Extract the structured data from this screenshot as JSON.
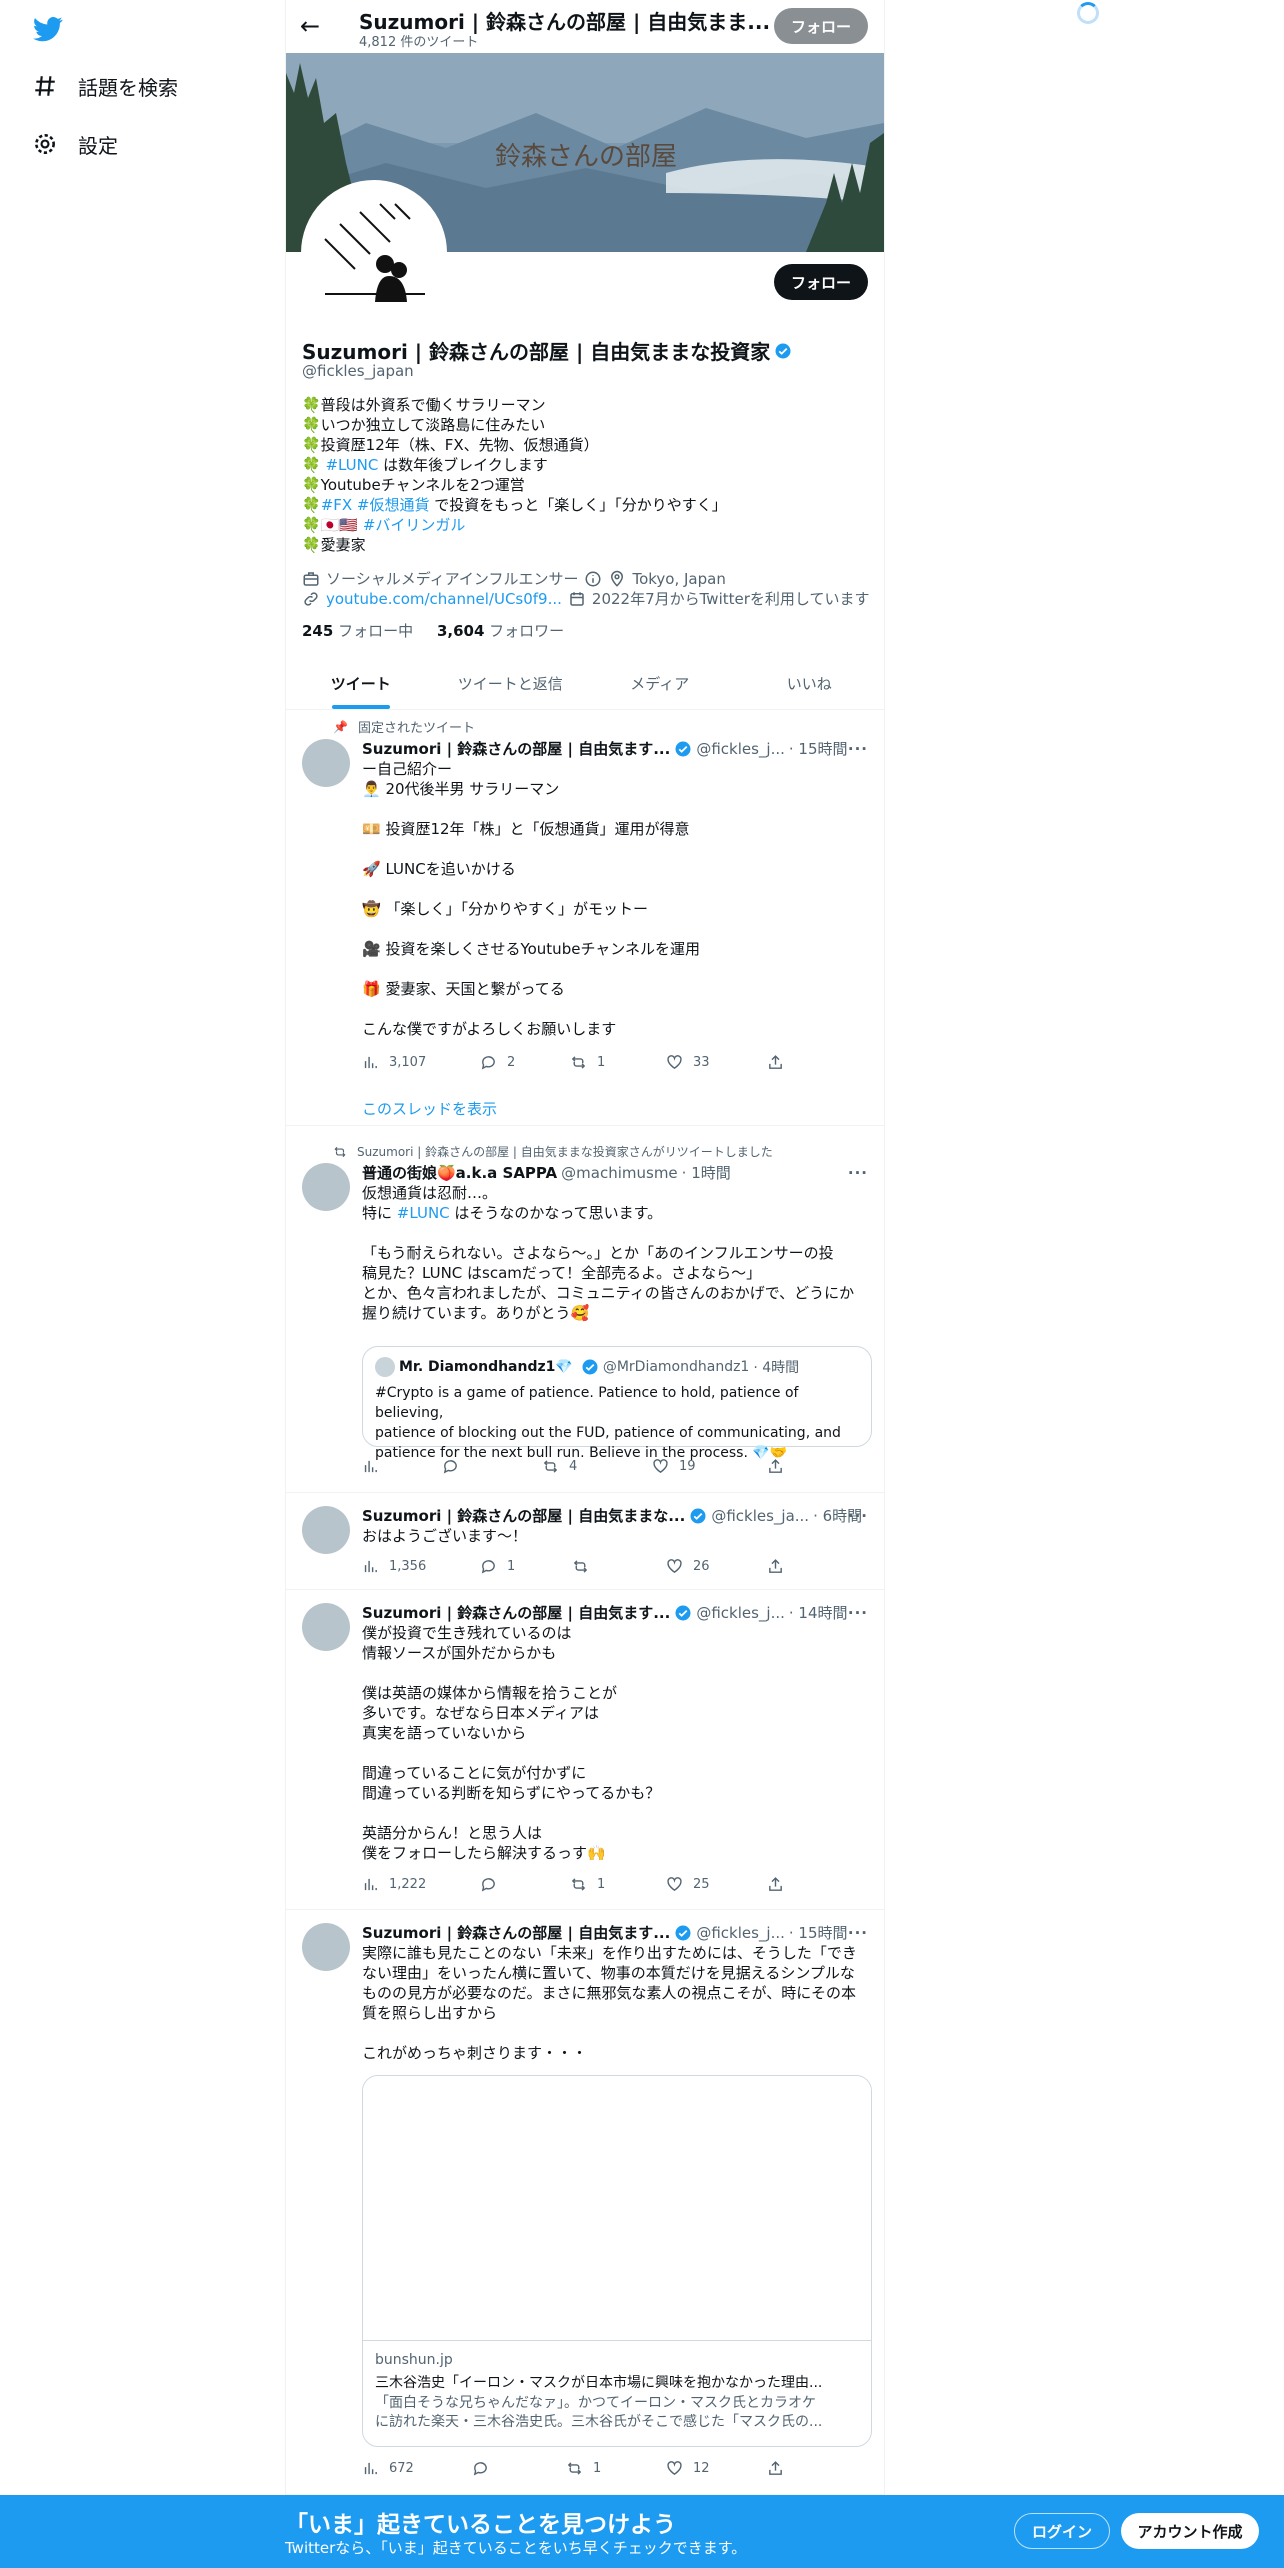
{
  "nav": {
    "explore": "話題を検索",
    "settings": "設定"
  },
  "topbar": {
    "name": "Suzumori | 鈴森さんの部屋 | 自由気まま...",
    "count": "4,812 件のツイート",
    "follow": "フォロー"
  },
  "banner": {
    "text": "鈴森さんの部屋"
  },
  "profile": {
    "follow": "フォロー",
    "name": "Suzumori | 鈴森さんの部屋 | 自由気ままな投資家",
    "handle": "@fickles_japan",
    "bio": [
      "🍀普段は外資系で働くサラリーマン",
      "🍀いつか独立して淡路島に住みたい",
      "🍀投資歴12年（株、FX、先物、仮想通貨）",
      "🍀",
      "🍀Youtubeチャンネルを2つ運営",
      "🍀",
      "🍀",
      "🍀愛妻家"
    ],
    "bio_tag1": "#LUNC",
    "bio_line4_rest": " は数年後ブレイクします",
    "bio_tags6": "#FX #仮想通貨",
    "bio_line6_rest": " で投資をもっと「楽しく」「分かりやすく」",
    "bio_flags": "🇯🇵🇺🇸 ",
    "bio_tag7": "#バイリンガル",
    "category": "ソーシャルメディアインフルエンサー",
    "location": "Tokyo, Japan",
    "url": "youtube.com/channel/UCs0f9...",
    "joined": "2022年7月からTwitterを利用しています",
    "following_count": "245",
    "following_label": " フォロー中",
    "followers_count": "3,604",
    "followers_label": " フォロワー"
  },
  "tabs": [
    "ツイート",
    "ツイートと返信",
    "メディア",
    "いいね"
  ],
  "tweets": [
    {
      "context": "固定されたツイート",
      "name": "Suzumori | 鈴森さんの部屋 | 自由気ます...",
      "handle": "@fickles_j...",
      "time": "· 15時間",
      "lines": [
        "ー自己紹介ー",
        "👨‍💼 20代後半男 サラリーマン",
        "",
        "💴 投資歴12年「株」と「仮想通貨」運用が得意",
        "",
        "🚀 LUNCを追いかける",
        "",
        "🤠 「楽しく」「分かりやすく」がモットー",
        "",
        "🎥 投資を楽しくさせるYoutubeチャンネルを運用",
        "",
        "🎁 愛妻家、天国と繋がってる",
        "",
        "こんな僕ですがよろしくお願いします"
      ],
      "views": "3,107",
      "replies": "2",
      "retweets": "1",
      "likes": "33",
      "thread": "このスレッドを表示"
    },
    {
      "context": "Suzumori | 鈴森さんの部屋 | 自由気ままな投資家さんがリツイートしました",
      "name": "普通の街娘🍑a.k.a SAPPA",
      "handle": "@machimusme",
      "time": "· 1時間",
      "lines": [
        "仮想通貨は忍耐…。",
        "特に ",
        "",
        "「もう耐えられない。さよなら～。」とか「あのインフルエンサーの投",
        "稿見た？LUNC はscamだって！全部売るよ。さよなら～」",
        "とか、色々言われましたが、コミュニティの皆さんのおかげで、どうにか",
        "握り続けています。ありがとう🥰"
      ],
      "tag": "#LUNC",
      "line2_rest": " はそうなのかなって思います。",
      "quote": {
        "name": "Mr. Diamondhandz1💎",
        "handle": "@MrDiamondhandz1",
        "time": "· 4時間",
        "lines": [
          "#Crypto is a game of patience. Patience to hold, patience of believing,",
          "patience of blocking out the FUD, patience of communicating, and",
          "patience for the next bull run. Believe in the process. 💎🤝"
        ]
      },
      "views": "",
      "replies": "",
      "retweets": "4",
      "likes": "19"
    },
    {
      "name": "Suzumori | 鈴森さんの部屋 | 自由気ままな...",
      "handle": "@fickles_ja...",
      "time": "· 6時間",
      "lines": [
        "おはようございます〜！"
      ],
      "views": "1,356",
      "replies": "1",
      "retweets": "",
      "likes": "26"
    },
    {
      "name": "Suzumori | 鈴森さんの部屋 | 自由気ます...",
      "handle": "@fickles_j...",
      "time": "· 14時間",
      "lines": [
        "僕が投資で生き残れているのは",
        "情報ソースが国外だからかも",
        "",
        "僕は英語の媒体から情報を拾うことが",
        "多いです。なぜなら日本メディアは",
        "真実を語っていないから",
        "",
        "間違っていることに気が付かずに",
        "間違っている判断を知らずにやってるかも？",
        "",
        "英語分からん！と思う人は",
        "僕をフォローしたら解決するっす🙌"
      ],
      "views": "1,222",
      "replies": "",
      "retweets": "1",
      "likes": "25"
    },
    {
      "name": "Suzumori | 鈴森さんの部屋 | 自由気ます...",
      "handle": "@fickles_j...",
      "time": "· 15時間",
      "lines": [
        "実際に誰も見たことのない「未来」を作り出すためには、そうした「でき",
        "ない理由」をいったん横に置いて、物事の本質だけを見据えるシンプルな",
        "ものの見方が必要なのだ。まさに無邪気な素人の視点こそが、時にその本",
        "質を照らし出すから",
        "",
        "これがめっちゃ刺さります・・・"
      ],
      "card": {
        "domain": "bunshun.jp",
        "title": "三木谷浩史「イーロン・マスクが日本市場に興味を抱かなかった理由...",
        "desc": [
          "「面白そうな兄ちゃんだなァ」。かつてイーロン・マスク氏とカラオケ",
          "に訪れた楽天・三木谷浩史氏。三木谷氏がそこで感じた「マスク氏の..."
        ]
      },
      "views": "672",
      "replies": "",
      "retweets": "1",
      "likes": "12"
    }
  ],
  "bottom": {
    "title": "「いま」起きていることを見つけよう",
    "subtitle": "Twitterなら、「いま」起きていることをいち早くチェックできます。",
    "login": "ログイン",
    "signup": "アカウント作成"
  },
  "colors": {
    "accent": "#1d9bf0",
    "text": "#0f1419",
    "muted": "#536471"
  }
}
